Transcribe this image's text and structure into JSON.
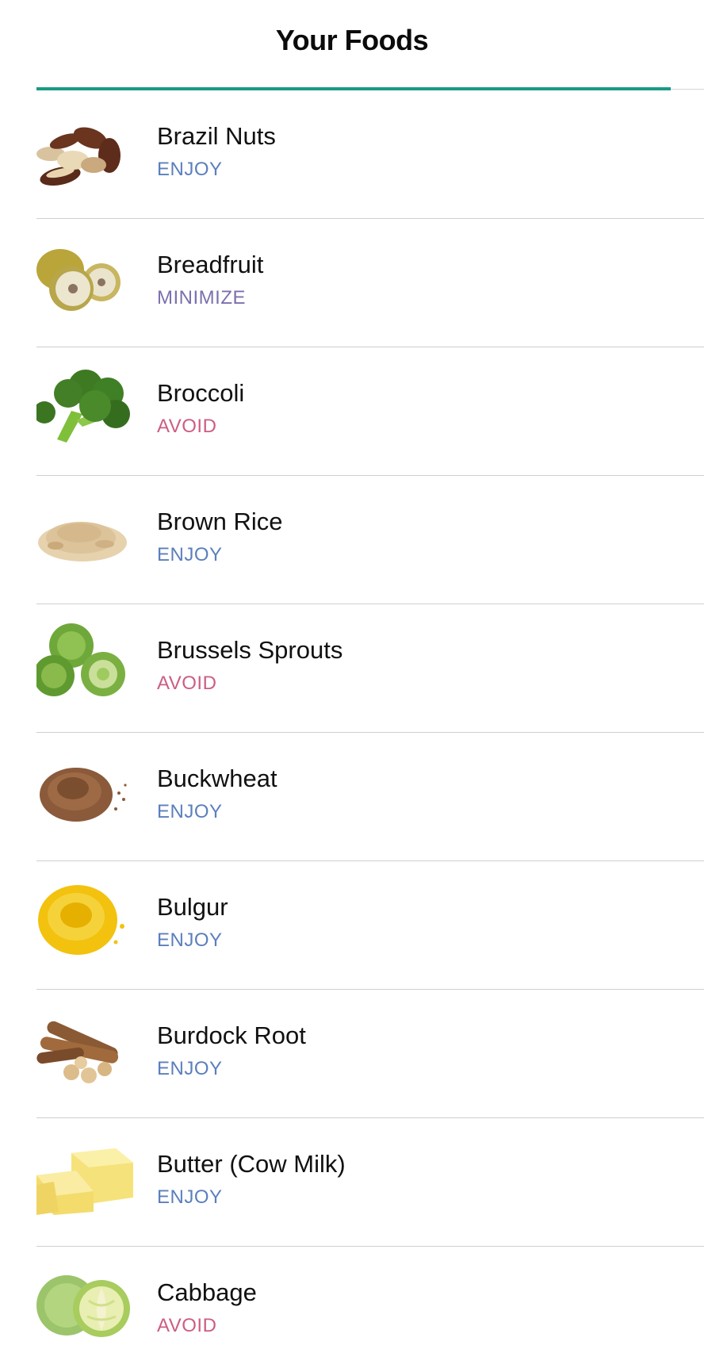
{
  "header": {
    "title": "Your Foods"
  },
  "colors": {
    "accent": "#1a9a84",
    "ENJOY": "#5b7fbd",
    "MINIMIZE": "#7d6fae",
    "AVOID": "#cc5e80"
  },
  "foods": [
    {
      "name": "Brazil Nuts",
      "status": "ENJOY",
      "icon": "brazil-nuts"
    },
    {
      "name": "Breadfruit",
      "status": "MINIMIZE",
      "icon": "breadfruit"
    },
    {
      "name": "Broccoli",
      "status": "AVOID",
      "icon": "broccoli"
    },
    {
      "name": "Brown Rice",
      "status": "ENJOY",
      "icon": "brown-rice"
    },
    {
      "name": "Brussels Sprouts",
      "status": "AVOID",
      "icon": "brussels-sprouts"
    },
    {
      "name": "Buckwheat",
      "status": "ENJOY",
      "icon": "buckwheat"
    },
    {
      "name": "Bulgur",
      "status": "ENJOY",
      "icon": "bulgur"
    },
    {
      "name": "Burdock Root",
      "status": "ENJOY",
      "icon": "burdock-root"
    },
    {
      "name": "Butter (Cow Milk)",
      "status": "ENJOY",
      "icon": "butter"
    },
    {
      "name": "Cabbage",
      "status": "AVOID",
      "icon": "cabbage"
    }
  ]
}
